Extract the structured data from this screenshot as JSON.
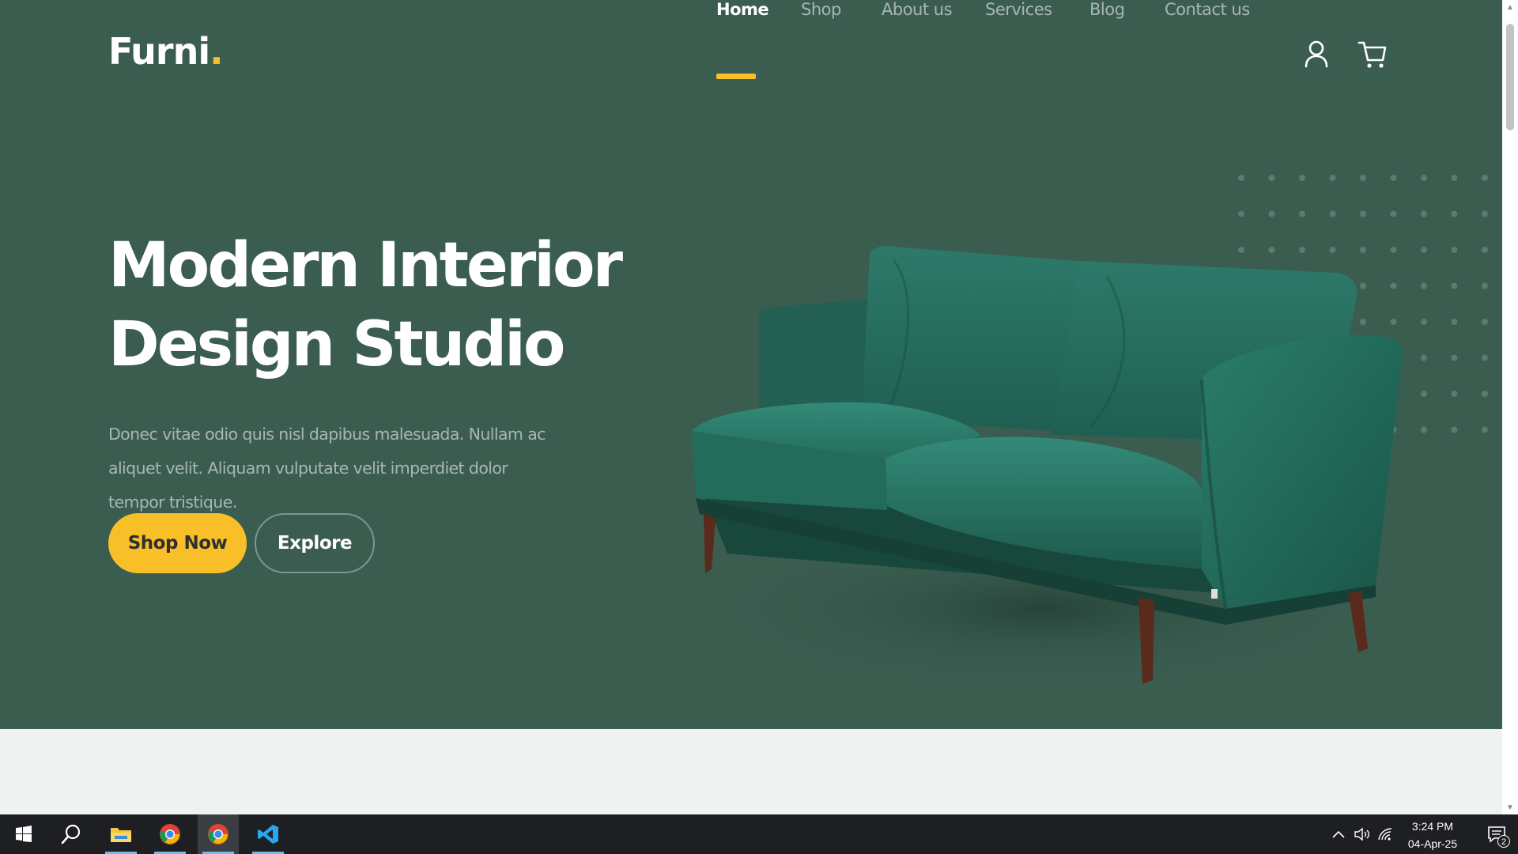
{
  "site": {
    "logo_text": "Furni",
    "logo_dot": "."
  },
  "nav": {
    "items": [
      {
        "label": "Home",
        "active": true
      },
      {
        "label": "Shop",
        "active": false
      },
      {
        "label": "About us",
        "active": false
      },
      {
        "label": "Services",
        "active": false
      },
      {
        "label": "Blog",
        "active": false
      },
      {
        "label": "Contact us",
        "active": false
      }
    ],
    "icons": [
      "user-icon",
      "cart-icon"
    ]
  },
  "hero": {
    "title_line1": "Modern Interior",
    "title_line2": "Design Studio",
    "description": "Donec vitae odio quis nisl dapibus malesuada. Nullam ac aliquet velit. Aliquam vulputate velit imperdiet dolor tempor tristique.",
    "primary_button": "Shop Now",
    "secondary_button": "Explore",
    "image": "green-velvet-sofa"
  },
  "colors": {
    "hero_bg": "#3b5d50",
    "accent": "#f9bf29",
    "page_bg": "#eff2f1",
    "taskbar_bg": "#1d1f22"
  },
  "taskbar": {
    "apps": [
      "start-icon",
      "search-icon",
      "file-explorer-icon",
      "chrome-icon",
      "chrome-icon",
      "vscode-icon"
    ],
    "tray_icons": [
      "chevron-up-icon",
      "speaker-icon",
      "wifi-icon"
    ],
    "time": "3:24 PM",
    "date": "04-Apr-25",
    "notification_count": "2"
  }
}
